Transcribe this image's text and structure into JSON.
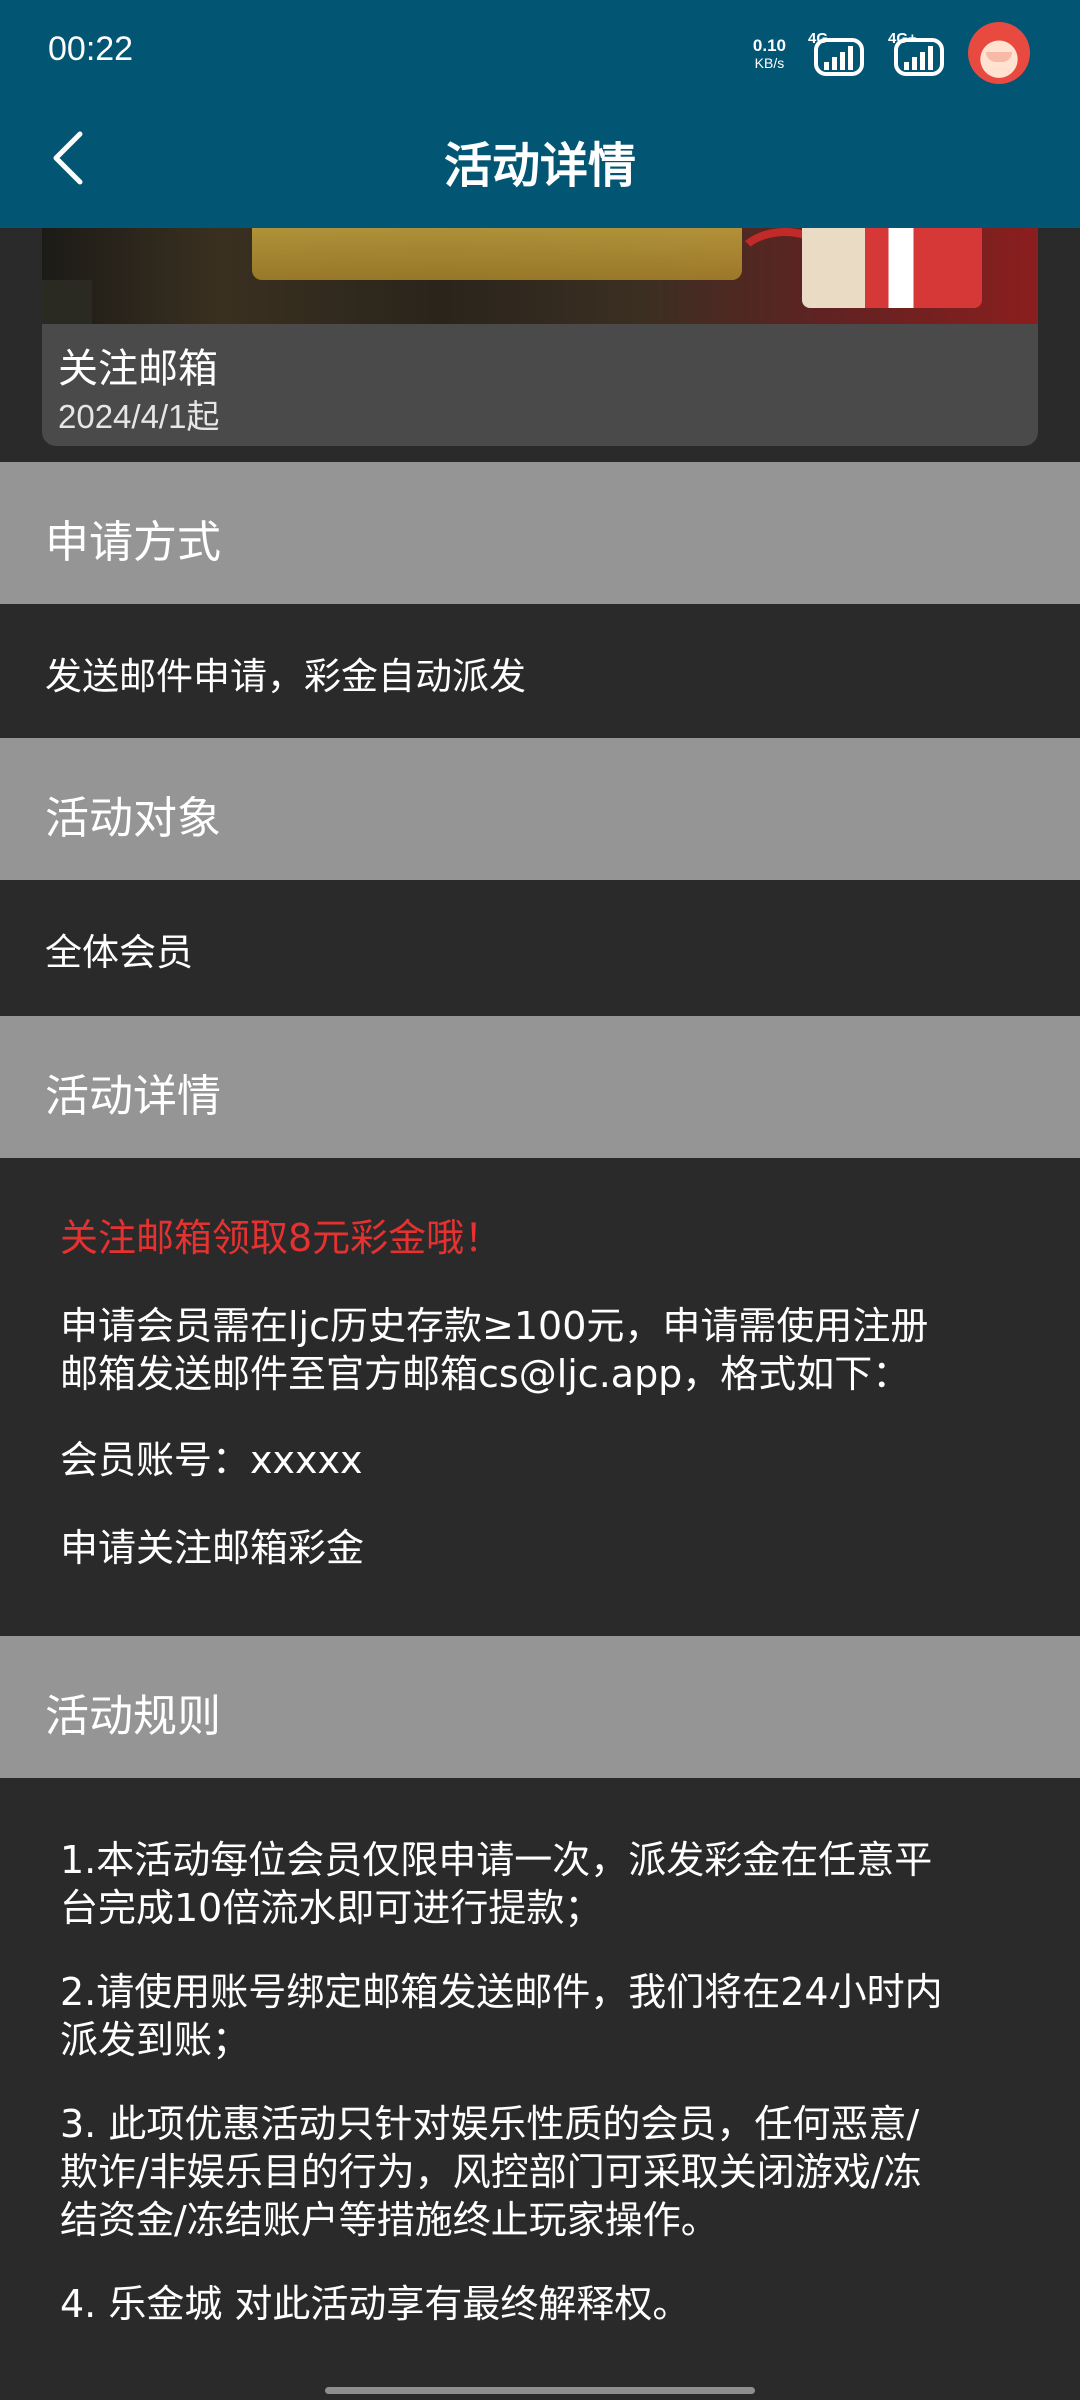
{
  "status_bar": {
    "time": "00:22",
    "net_speed_value": "0.10",
    "net_speed_unit": "KB/s",
    "signal_1_label": "4G",
    "signal_2_label": "4G+",
    "icons": [
      "signal-4g-icon",
      "signal-4g-plus-icon",
      "avatar-icon"
    ]
  },
  "header": {
    "title": "活动详情",
    "back_icon": "chevron-left-icon"
  },
  "colors": {
    "header_bg": "#035673",
    "section_header_bg": "#959595",
    "body_bg": "#2a2a2b",
    "highlight_red": "#e5312f"
  },
  "banner": {
    "title": "关注邮箱",
    "date": "2024/4/1起"
  },
  "sections": {
    "method": {
      "header": "申请方式",
      "body": "发送邮件申请，彩金自动派发"
    },
    "target": {
      "header": "活动对象",
      "body": "全体会员"
    },
    "details": {
      "header": "活动详情",
      "highlight": "关注邮箱领取8元彩金哦！",
      "para_1_line_1": "申请会员需在ljc历史存款≥100元，申请需使用注册",
      "para_1_line_2": "邮箱发送邮件至官方邮箱cs@ljc.app，格式如下：",
      "para_2": "会员账号：xxxxx",
      "para_3": "申请关注邮箱彩金"
    },
    "rules": {
      "header": "活动规则",
      "rule_1_line_1": "1.本活动每位会员仅限申请一次，派发彩金在任意平",
      "rule_1_line_2": "台完成10倍流水即可进行提款；",
      "rule_2_line_1": "2.请使用账号绑定邮箱发送邮件，我们将在24小时内",
      "rule_2_line_2": "派发到账；",
      "rule_3_line_1": "3. 此项优惠活动只针对娱乐性质的会员，任何恶意/",
      "rule_3_line_2": "欺诈/非娱乐目的行为，风控部门可采取关闭游戏/冻",
      "rule_3_line_3": "结资金/冻结账户等措施终止玩家操作。",
      "rule_4": "4. 乐金城 对此活动享有最终解释权。"
    }
  }
}
